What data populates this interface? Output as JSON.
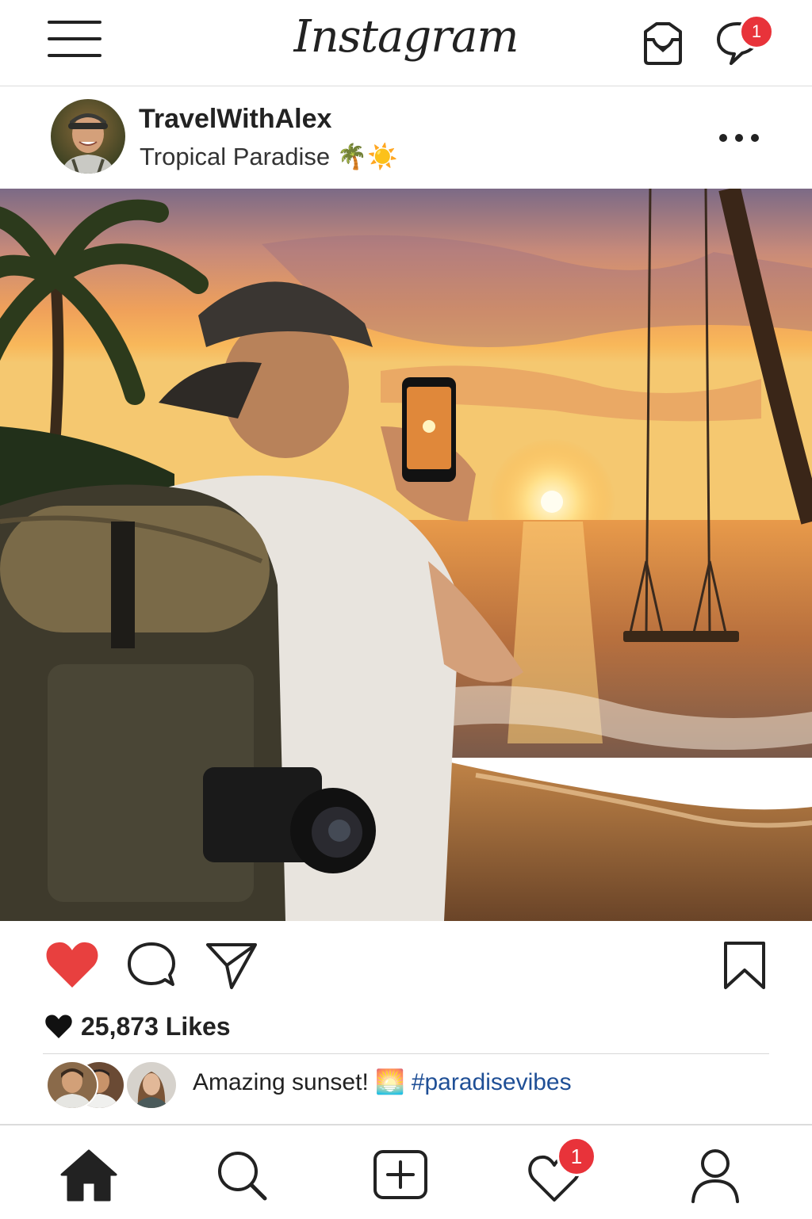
{
  "app": {
    "logo_text": "Instagram"
  },
  "header": {
    "menu_icon": "hamburger-menu-icon",
    "inbox_icon": "inbox-tray-icon",
    "messages_icon": "chat-bubble-icon",
    "messages_badge": "1"
  },
  "post": {
    "username": "TravelWithAlex",
    "location": "Tropical Paradise 🌴☀️",
    "more_icon": "more-dots-icon",
    "likes_text": "25,873 Likes",
    "caption_text": "Amazing sunset! 🌅",
    "caption_hashtag": "#paradisevibes"
  },
  "colors": {
    "like_red": "#e8403f",
    "badge_red": "#e8333a",
    "hashtag_blue": "#1f4f96"
  },
  "tabbar": {
    "tabs": [
      {
        "name": "home",
        "icon": "home-icon"
      },
      {
        "name": "search",
        "icon": "search-icon"
      },
      {
        "name": "create",
        "icon": "add-post-icon"
      },
      {
        "name": "activity",
        "icon": "heart-icon"
      },
      {
        "name": "profile",
        "icon": "profile-icon"
      }
    ],
    "activity_badge": "1"
  }
}
